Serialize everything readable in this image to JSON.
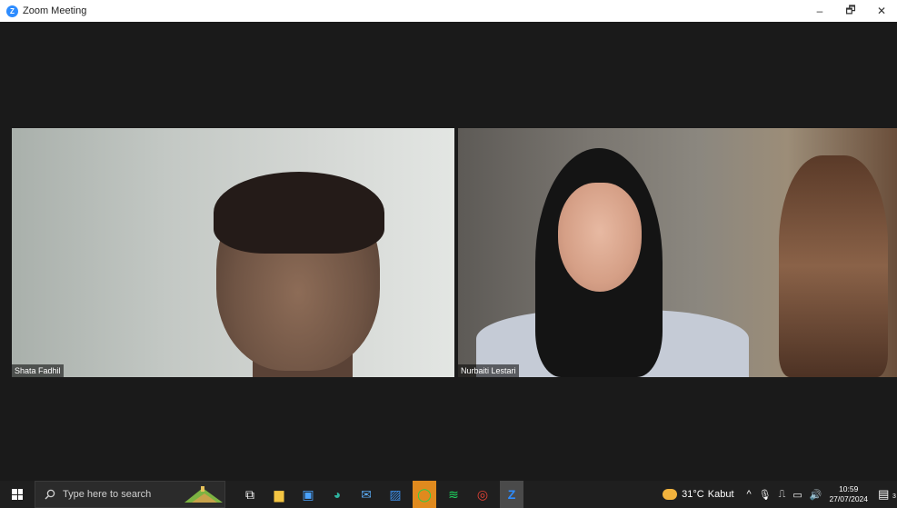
{
  "window": {
    "title": "Zoom Meeting",
    "app_icon": "zoom-icon",
    "controls": [
      {
        "name": "minimize-button",
        "icon": "minimize-icon",
        "glyph": "–"
      },
      {
        "name": "restore-button",
        "icon": "restore-icon",
        "glyph": "🗗"
      },
      {
        "name": "close-button",
        "icon": "close-icon",
        "glyph": "✕"
      }
    ]
  },
  "meeting": {
    "participants": [
      {
        "name": "Shata Fadhil"
      },
      {
        "name": "Nurbaiti Lestari"
      }
    ]
  },
  "taskbar": {
    "search_placeholder": "Type here to search",
    "apps": [
      {
        "name": "task-view",
        "icon": "task-view-icon",
        "glyph": "⧉",
        "color": "#ffffff",
        "active": false
      },
      {
        "name": "file-explorer",
        "icon": "folder-icon",
        "glyph": "▆",
        "color": "#f4c542",
        "active": false
      },
      {
        "name": "store",
        "icon": "store-icon",
        "glyph": "▣",
        "color": "#4aa3ff",
        "active": false
      },
      {
        "name": "edge",
        "icon": "edge-icon",
        "glyph": "◕",
        "color": "#2fb5a0",
        "active": false
      },
      {
        "name": "mail",
        "icon": "mail-icon",
        "glyph": "✉",
        "color": "#5aa9f2",
        "active": false
      },
      {
        "name": "photos",
        "icon": "photos-icon",
        "glyph": "▨",
        "color": "#3d8ee8",
        "active": false
      },
      {
        "name": "whatsapp",
        "icon": "whatsapp-icon",
        "glyph": "◯",
        "color": "#27d045",
        "active": true
      },
      {
        "name": "spotify",
        "icon": "spotify-icon",
        "glyph": "≋",
        "color": "#1ed760",
        "active": false
      },
      {
        "name": "chrome",
        "icon": "chrome-icon",
        "glyph": "◎",
        "color": "#e94235",
        "active": false
      },
      {
        "name": "zoom",
        "icon": "zoom-icon",
        "glyph": "Z",
        "color": "#2d8cff",
        "active": true
      }
    ],
    "tray": {
      "weather_temp": "31°C",
      "weather_desc": "Kabut",
      "time": "10:59",
      "date": "27/07/2024",
      "notification_count": "3"
    }
  }
}
